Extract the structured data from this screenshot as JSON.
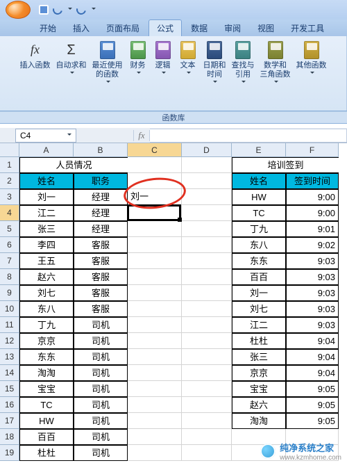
{
  "qat": {
    "save": "保存",
    "undo": "撤消",
    "redo": "重做"
  },
  "tabs": [
    "开始",
    "插入",
    "页面布局",
    "公式",
    "数据",
    "审阅",
    "视图",
    "开发工具"
  ],
  "active_tab": 3,
  "ribbon": {
    "insert_fn": "插入函数",
    "autosum": "自动求和",
    "recent": "最近使用\n的函数",
    "financial": "财务",
    "logical": "逻辑",
    "text": "文本",
    "datetime": "日期和\n时间",
    "lookup": "查找与\n引用",
    "math": "数学和\n三角函数",
    "other": "其他函数",
    "group_label": "函数库"
  },
  "namebox": "C4",
  "columns": [
    "A",
    "B",
    "C",
    "D",
    "E",
    "F"
  ],
  "active_col": 2,
  "active_row": 4,
  "active_cell_value": "",
  "sheet": {
    "title_left": "人员情况",
    "title_right": "培训签到",
    "h_name": "姓名",
    "h_duty": "职务",
    "h_name2": "姓名",
    "h_time": "签到时间",
    "left": [
      {
        "a": "刘一",
        "b": "经理"
      },
      {
        "a": "江二",
        "b": "经理"
      },
      {
        "a": "张三",
        "b": "经理"
      },
      {
        "a": "李四",
        "b": "客服"
      },
      {
        "a": "王五",
        "b": "客服"
      },
      {
        "a": "赵六",
        "b": "客服"
      },
      {
        "a": "刘七",
        "b": "客服"
      },
      {
        "a": "东八",
        "b": "客服"
      },
      {
        "a": "丁九",
        "b": "司机"
      },
      {
        "a": "京京",
        "b": "司机"
      },
      {
        "a": "东东",
        "b": "司机"
      },
      {
        "a": "淘淘",
        "b": "司机"
      },
      {
        "a": "宝宝",
        "b": "司机"
      },
      {
        "a": "TC",
        "b": "司机"
      },
      {
        "a": "HW",
        "b": "司机"
      },
      {
        "a": "百百",
        "b": "司机"
      },
      {
        "a": "杜杜",
        "b": "司机"
      }
    ],
    "c3": "刘一",
    "right": [
      {
        "e": "HW",
        "f": "9:00"
      },
      {
        "e": "TC",
        "f": "9:00"
      },
      {
        "e": "丁九",
        "f": "9:01"
      },
      {
        "e": "东八",
        "f": "9:02"
      },
      {
        "e": "东东",
        "f": "9:03"
      },
      {
        "e": "百百",
        "f": "9:03"
      },
      {
        "e": "刘一",
        "f": "9:03"
      },
      {
        "e": "刘七",
        "f": "9:03"
      },
      {
        "e": "江二",
        "f": "9:03"
      },
      {
        "e": "杜杜",
        "f": "9:04"
      },
      {
        "e": "张三",
        "f": "9:04"
      },
      {
        "e": "京京",
        "f": "9:04"
      },
      {
        "e": "宝宝",
        "f": "9:05"
      },
      {
        "e": "赵六",
        "f": "9:05"
      },
      {
        "e": "淘淘",
        "f": "9:05"
      }
    ]
  },
  "watermark": {
    "name": "纯净系统之家",
    "url": "www.kzmhome.com"
  }
}
